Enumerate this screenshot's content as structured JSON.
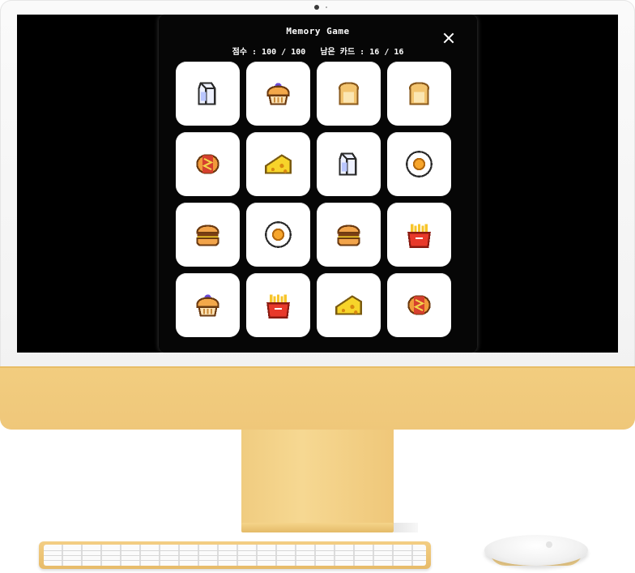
{
  "game": {
    "title": "Memory Game",
    "close_icon": "close-icon",
    "score_label": "점수 :",
    "score_value": "100",
    "score_max": "100",
    "remaining_label": "남은 카드 :",
    "remaining_value": "16",
    "remaining_max": "16",
    "separator": "/"
  },
  "cards": [
    {
      "icon": "milk-carton-icon"
    },
    {
      "icon": "muffin-icon"
    },
    {
      "icon": "toast-icon"
    },
    {
      "icon": "toast-icon"
    },
    {
      "icon": "hotdog-icon"
    },
    {
      "icon": "cheese-icon"
    },
    {
      "icon": "milk-carton-icon"
    },
    {
      "icon": "fried-egg-icon"
    },
    {
      "icon": "burger-icon"
    },
    {
      "icon": "fried-egg-icon"
    },
    {
      "icon": "burger-icon"
    },
    {
      "icon": "fries-icon"
    },
    {
      "icon": "muffin-icon"
    },
    {
      "icon": "fries-icon"
    },
    {
      "icon": "cheese-icon"
    },
    {
      "icon": "hotdog-icon"
    }
  ],
  "colors": {
    "screen_bg": "#000000",
    "panel_bg": "#060606",
    "card_bg": "#ffffff",
    "frame_accent": "#efc77a"
  }
}
